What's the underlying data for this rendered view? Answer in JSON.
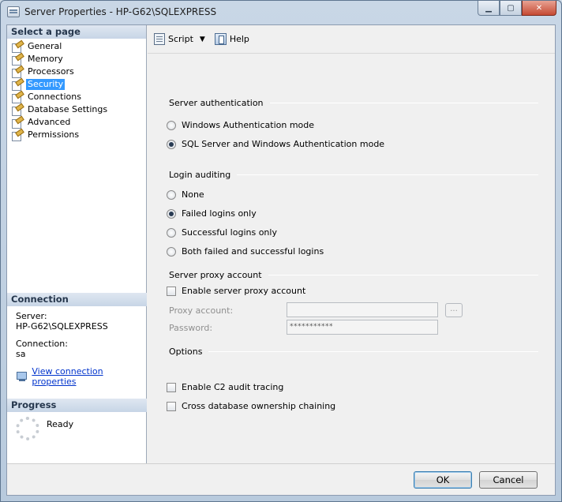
{
  "window": {
    "title": "Server Properties - HP-G62\\SQLEXPRESS",
    "controls": {
      "minimize": "▁",
      "maximize": "▢",
      "close": "✕"
    }
  },
  "left": {
    "select_page_header": "Select a page",
    "pages": [
      {
        "label": "General",
        "icon": "page-icon"
      },
      {
        "label": "Memory",
        "icon": "page-icon"
      },
      {
        "label": "Processors",
        "icon": "page-icon"
      },
      {
        "label": "Security",
        "icon": "page-icon",
        "selected": true
      },
      {
        "label": "Connections",
        "icon": "page-icon"
      },
      {
        "label": "Database Settings",
        "icon": "page-icon"
      },
      {
        "label": "Advanced",
        "icon": "page-icon"
      },
      {
        "label": "Permissions",
        "icon": "page-icon"
      }
    ],
    "connection": {
      "header": "Connection",
      "server_label": "Server:",
      "server_value": "HP-G62\\SQLEXPRESS",
      "connection_label": "Connection:",
      "connection_value": "sa",
      "view_link": "View connection properties"
    },
    "progress": {
      "header": "Progress",
      "status": "Ready"
    }
  },
  "toolbar": {
    "script_label": "Script",
    "help_label": "Help"
  },
  "security": {
    "server_auth": {
      "heading": "Server authentication",
      "windows_mode": "Windows Authentication mode",
      "mixed_mode": "SQL Server and Windows Authentication mode",
      "selected": "mixed_mode"
    },
    "login_auditing": {
      "heading": "Login auditing",
      "none": "None",
      "failed": "Failed logins only",
      "successful": "Successful logins only",
      "both": "Both failed and successful logins",
      "selected": "failed"
    },
    "proxy": {
      "heading": "Server proxy account",
      "enable_label": "Enable server proxy account",
      "enable_checked": false,
      "account_label": "Proxy account:",
      "account_value": "",
      "password_label": "Password:",
      "password_value": "***********",
      "browse_label": "..."
    },
    "options": {
      "heading": "Options",
      "c2_label": "Enable C2 audit tracing",
      "c2_checked": false,
      "chaining_label": "Cross database ownership chaining",
      "chaining_checked": false
    }
  },
  "buttons": {
    "ok": "OK",
    "cancel": "Cancel"
  }
}
